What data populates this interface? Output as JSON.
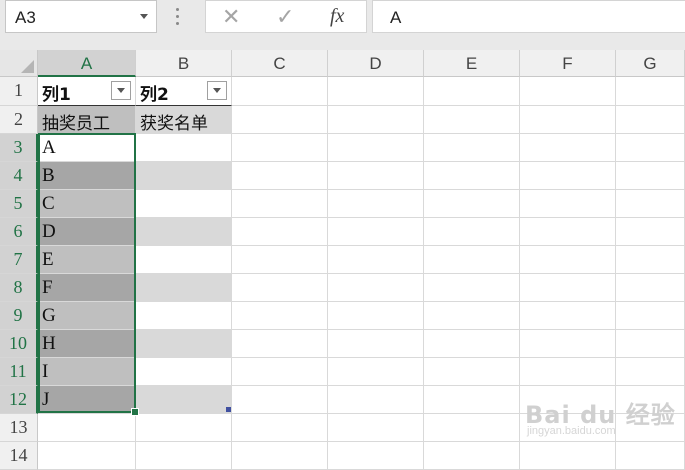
{
  "formula_bar": {
    "name_box": "A3",
    "cancel_icon": "✕",
    "enter_icon": "✓",
    "fx_label": "fx",
    "value": "A"
  },
  "columns": [
    "A",
    "B",
    "C",
    "D",
    "E",
    "F",
    "G"
  ],
  "rows": [
    "1",
    "2",
    "3",
    "4",
    "5",
    "6",
    "7",
    "8",
    "9",
    "10",
    "11",
    "12",
    "13",
    "14"
  ],
  "table": {
    "headers": [
      "列1",
      "列2"
    ],
    "row2": [
      "抽奖员工",
      "获奖名单"
    ],
    "employees": [
      "A",
      "B",
      "C",
      "D",
      "E",
      "F",
      "G",
      "H",
      "I",
      "J"
    ]
  },
  "selection": {
    "active_cell": "A3",
    "range": "A3:A12",
    "accent_color": "#217346"
  },
  "watermark": {
    "brand": "Bai du 经验",
    "url": "jingyan.baidu.com"
  }
}
